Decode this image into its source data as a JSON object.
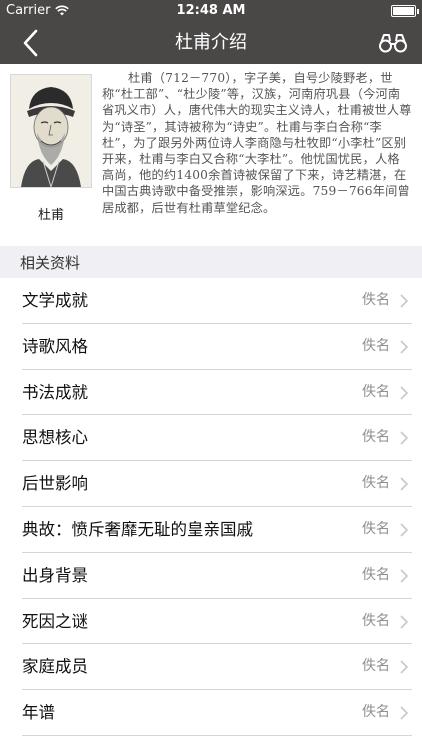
{
  "status_bar": {
    "carrier": "Carrier",
    "time": "12:48 AM",
    "wifi_icon": "wifi-icon",
    "battery_icon": "battery-icon"
  },
  "nav": {
    "title": "杜甫介绍",
    "back_icon": "chevron-left-icon",
    "search_icon": "binoculars-icon"
  },
  "intro": {
    "portrait_caption": "杜甫",
    "text": "杜甫（712－770），字子美，自号少陵野老，世称“杜工部”、“杜少陵”等，汉族，河南府巩县（今河南省巩义市）人，唐代伟大的现实主义诗人，杜甫被世人尊为“诗圣”，其诗被称为“诗史”。杜甫与李白合称“李杜”，为了跟另外两位诗人李商隐与杜牧即“小李杜”区别开来，杜甫与李白又合称“大李杜”。他忧国忧民，人格高尚，他的约1400余首诗被保留了下来，诗艺精湛，在中国古典诗歌中备受推崇，影响深远。759－766年间曾居成都，后世有杜甫草堂纪念。"
  },
  "section": {
    "title": "相关资料"
  },
  "items": [
    {
      "label": "文学成就",
      "author": "佚名"
    },
    {
      "label": "诗歌风格",
      "author": "佚名"
    },
    {
      "label": "书法成就",
      "author": "佚名"
    },
    {
      "label": "思想核心",
      "author": "佚名"
    },
    {
      "label": "后世影响",
      "author": "佚名"
    },
    {
      "label": "典故：愤斥奢靡无耻的皇亲国戚",
      "author": "佚名"
    },
    {
      "label": "出身背景",
      "author": "佚名"
    },
    {
      "label": "死因之谜",
      "author": "佚名"
    },
    {
      "label": "家庭成员",
      "author": "佚名"
    },
    {
      "label": "年谱",
      "author": "佚名"
    }
  ],
  "colors": {
    "nav_background": "#4a4747",
    "section_background": "#efeff4",
    "secondary_text": "#8e8e93"
  }
}
